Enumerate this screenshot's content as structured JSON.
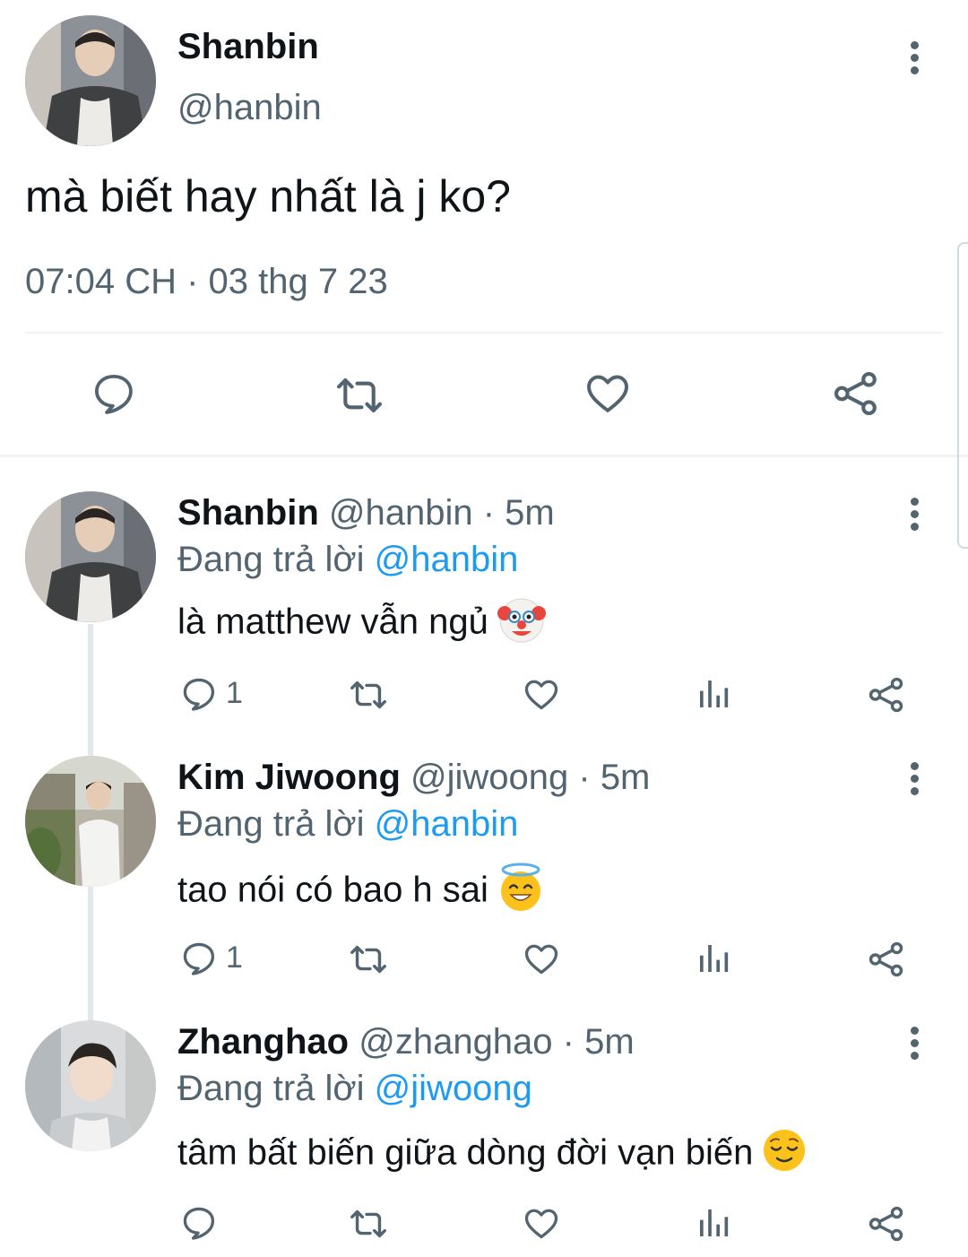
{
  "main_tweet": {
    "display_name": "Shanbin",
    "handle": "@hanbin",
    "text": "mà biết hay nhất là j ko?",
    "timestamp": "07:04 CH · 03 thg 7 23"
  },
  "replies": [
    {
      "display_name": "Shanbin",
      "meta": "@hanbin · 5m",
      "replying_prefix": "Đang trả lời",
      "replying_to": "@hanbin",
      "text": "là matthew vẫn ngủ",
      "emoji": "clown-face",
      "reply_count": "1"
    },
    {
      "display_name": "Kim Jiwoong",
      "meta": "@jiwoong · 5m",
      "replying_prefix": "Đang trả lời",
      "replying_to": "@hanbin",
      "text": "tao nói có bao h sai",
      "emoji": "smiling-face-with-halo",
      "reply_count": "1"
    },
    {
      "display_name": "Zhanghao",
      "meta": "@zhanghao · 5m",
      "replying_prefix": "Đang trả lời",
      "replying_to": "@jiwoong",
      "text": "tâm bất biến giữa dòng đời vạn biến",
      "emoji": "relieved-face",
      "reply_count": ""
    }
  ],
  "colors": {
    "text": "#0f1419",
    "secondary": "#536471",
    "link": "#1d9bf0",
    "divider": "#eff3f4",
    "thread_line": "#e1e8ed"
  }
}
